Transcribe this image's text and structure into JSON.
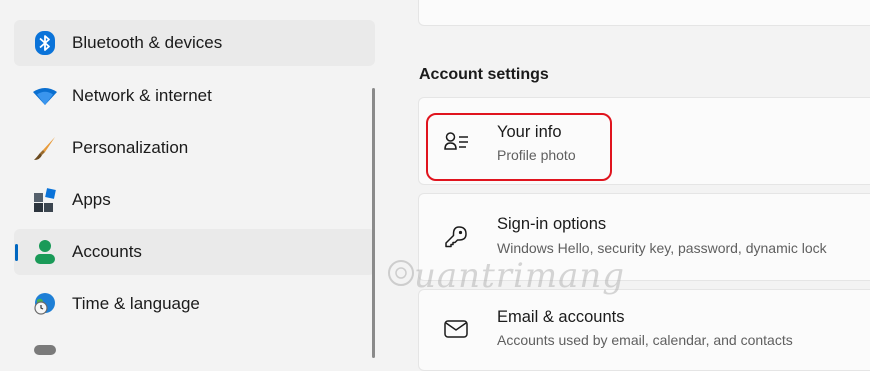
{
  "sidebar": {
    "items": [
      {
        "label": "Bluetooth & devices",
        "icon": "bluetooth-icon"
      },
      {
        "label": "Network & internet",
        "icon": "wifi-icon"
      },
      {
        "label": "Personalization",
        "icon": "brush-icon"
      },
      {
        "label": "Apps",
        "icon": "apps-icon"
      },
      {
        "label": "Accounts",
        "icon": "accounts-icon",
        "selected": true
      },
      {
        "label": "Time & language",
        "icon": "globe-clock-icon"
      }
    ]
  },
  "main": {
    "section_title": "Account settings",
    "cards": [
      {
        "title": "Your info",
        "subtitle": "Profile photo",
        "icon": "your-info-icon"
      },
      {
        "title": "Sign-in options",
        "subtitle": "Windows Hello, security key, password, dynamic lock",
        "icon": "key-icon"
      },
      {
        "title": "Email & accounts",
        "subtitle": "Accounts used by email, calendar, and contacts",
        "icon": "mail-icon"
      }
    ]
  },
  "watermark": {
    "text": "uantrimang"
  },
  "colors": {
    "accent": "#0067c0",
    "highlight": "#e0141e",
    "background": "#f3f3f3",
    "card": "#fbfbfb"
  }
}
